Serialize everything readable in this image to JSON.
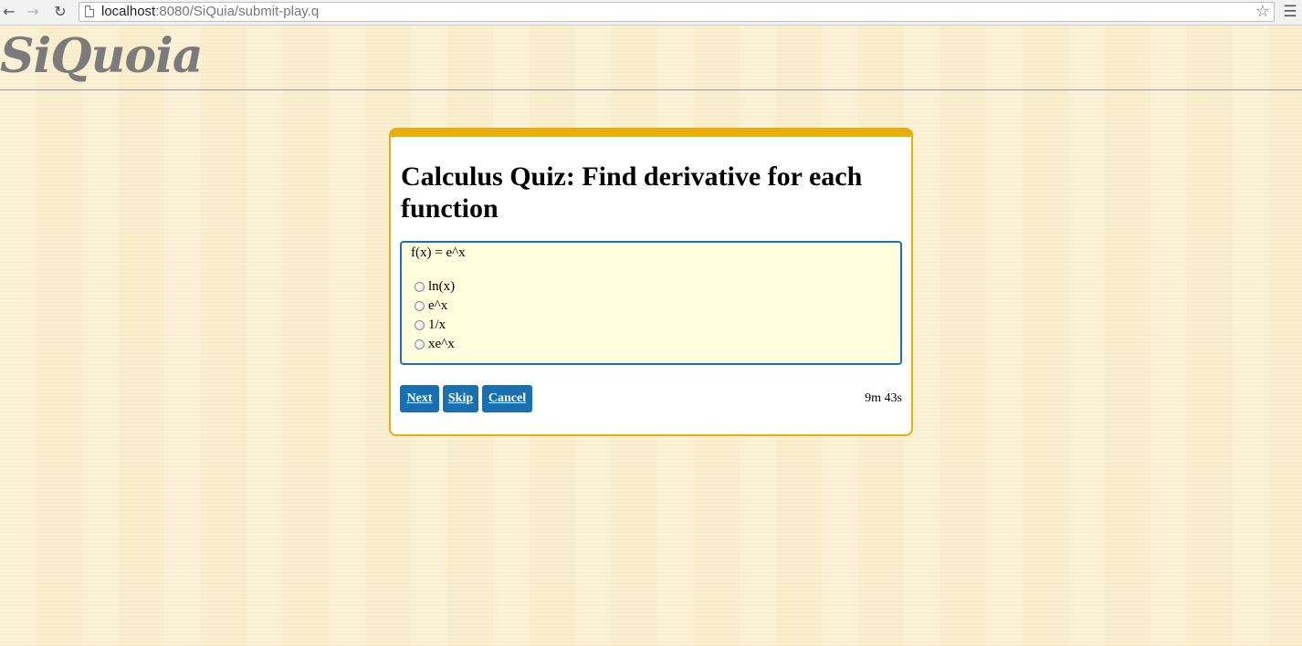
{
  "browser": {
    "url_host": "localhost",
    "url_rest": ":8080/SiQuia/submit-play.q"
  },
  "site": {
    "logo": "SiQuoia"
  },
  "quiz": {
    "title": "Calculus Quiz: Find derivative for each function",
    "question": "f(x) = e^x",
    "options": [
      {
        "label": "ln(x)"
      },
      {
        "label": "e^x"
      },
      {
        "label": "1/x"
      },
      {
        "label": "xe^x"
      }
    ],
    "buttons": {
      "next": "Next",
      "skip": "Skip",
      "cancel": "Cancel"
    },
    "timer": "9m 43s"
  },
  "colors": {
    "accent": "#e8ae0e",
    "button": "#1a6fae",
    "question_bg": "#ffffdd"
  },
  "icons": {
    "back": "back-arrow-icon",
    "forward": "forward-arrow-icon",
    "reload": "reload-icon",
    "page": "page-icon",
    "star": "star-icon",
    "menu": "hamburger-menu-icon"
  }
}
